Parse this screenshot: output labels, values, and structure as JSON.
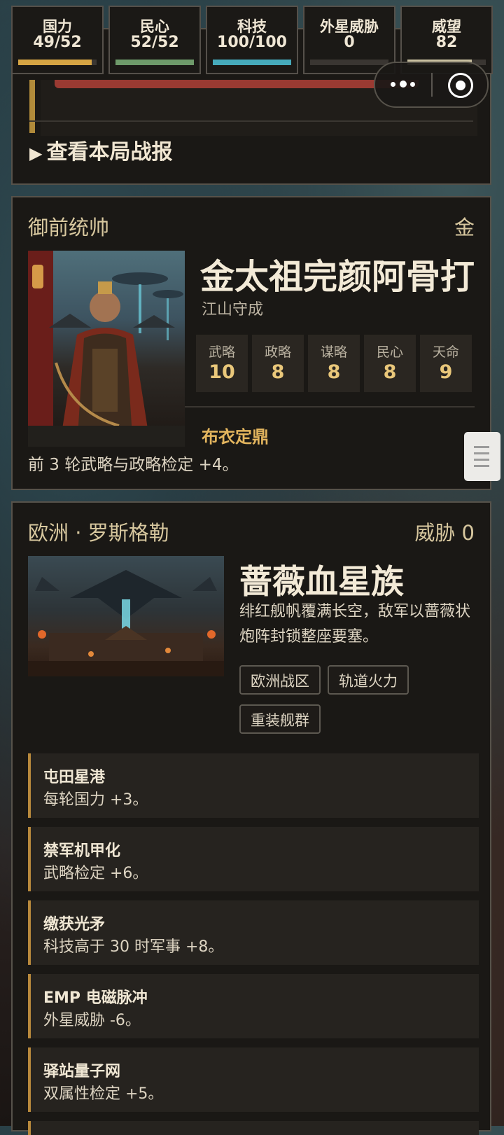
{
  "stats": [
    {
      "label": "国力",
      "value": "49/52",
      "fill": 0.94,
      "color": "#d6a544"
    },
    {
      "label": "民心",
      "value": "52/52",
      "fill": 1.0,
      "color": "#6e9a6a"
    },
    {
      "label": "科技",
      "value": "100/100",
      "fill": 1.0,
      "color": "#46aabb"
    },
    {
      "label": "外星威胁",
      "value": "0",
      "fill": 0.0,
      "color": "#8a3a32"
    },
    {
      "label": "威望",
      "value": "82",
      "fill": 0.82,
      "color": "#c9c0a0"
    }
  ],
  "battle": {
    "link_icon": "▶",
    "link": "查看本局战报"
  },
  "commander": {
    "role": "御前统帅",
    "dynasty": "金",
    "name": "金太祖完颜阿骨打",
    "subtitle": "江山守成",
    "attributes": [
      {
        "label": "武略",
        "value": "10"
      },
      {
        "label": "政略",
        "value": "8"
      },
      {
        "label": "谋略",
        "value": "8"
      },
      {
        "label": "民心",
        "value": "8"
      },
      {
        "label": "天命",
        "value": "9"
      }
    ],
    "skill_name": "布衣定鼎",
    "skill_desc": "前 3 轮武略与政略检定 +4。"
  },
  "enemy": {
    "region": "欧洲 · 罗斯格勒",
    "threat": "威胁 0",
    "name": "蔷薇血星族",
    "desc": "绯红舰帆覆满长空，敌军以蔷薇状炮阵封锁整座要塞。",
    "tags": [
      "欧洲战区",
      "轨道火力",
      "重装舰群"
    ],
    "traits": [
      {
        "title": "屯田星港",
        "desc": "每轮国力 +3。"
      },
      {
        "title": "禁军机甲化",
        "desc": "武略检定 +6。"
      },
      {
        "title": "缴获光矛",
        "desc": "科技高于 30 时军事 +8。"
      },
      {
        "title": "EMP 电磁脉冲",
        "desc": "外星威胁 -6。"
      },
      {
        "title": "驿站量子网",
        "desc": "双属性检定 +5。"
      }
    ]
  }
}
